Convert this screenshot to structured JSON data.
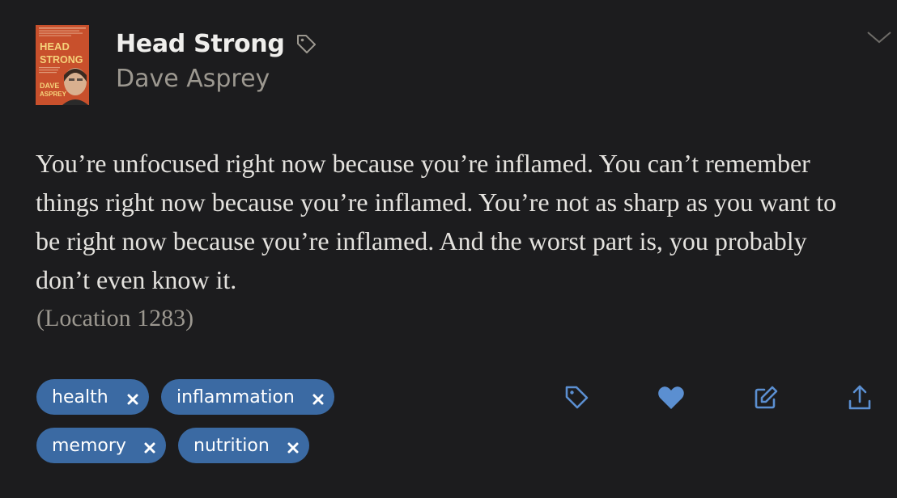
{
  "book": {
    "title": "Head Strong",
    "author": "Dave Asprey",
    "cover": {
      "title_line1": "HEAD",
      "title_line2": "STRONG",
      "author_line1": "DAVE",
      "author_line2": "ASPREY"
    }
  },
  "highlight": {
    "text": "You’re unfocused right now because you’re inflamed. You can’t remember things right now because you’re inflamed. You’re not as sharp as you want to be right now because you’re inflamed. And the worst part is, you probably don’t even know it.",
    "location": "(Location 1283)"
  },
  "tags": [
    {
      "label": "health"
    },
    {
      "label": "inflammation"
    },
    {
      "label": "memory"
    },
    {
      "label": "nutrition"
    }
  ],
  "icons": {
    "title_tag": "tag-icon",
    "collapse": "chevron-down-icon",
    "tag_action": "tag-icon",
    "favorite": "heart-icon",
    "edit": "edit-icon",
    "share": "share-icon",
    "remove": "close-icon"
  },
  "colors": {
    "background": "#1c1c1e",
    "accent": "#3b6aa3",
    "action_icon": "#5b8fd1",
    "text_primary": "#e4e2de",
    "text_secondary": "#9c9890"
  }
}
